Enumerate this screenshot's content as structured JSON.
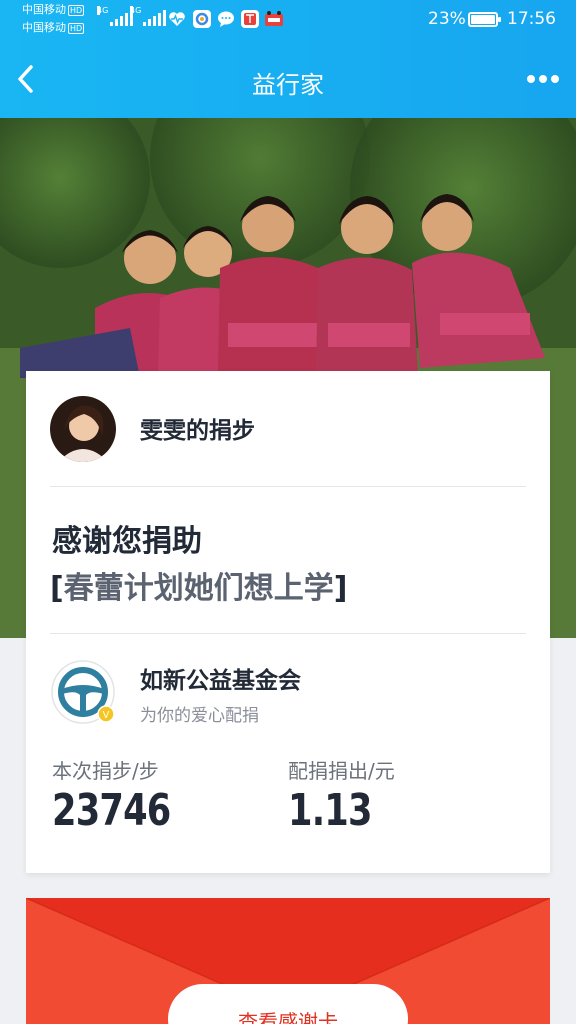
{
  "status_bar": {
    "carrier_1": "中国移动",
    "carrier_2": "中国移动",
    "hd_badge": "HD",
    "network": "4G",
    "battery": "23%",
    "time": "17:56"
  },
  "nav": {
    "title": "益行家",
    "back_icon": "chevron-left-icon",
    "more_icon": "more-dots-icon"
  },
  "donor": {
    "name": "雯雯的捐步"
  },
  "thanks": {
    "headline": "感谢您捐助",
    "project_name": "春蕾计划她们想上学",
    "bracket_open": "[",
    "bracket_close": "]"
  },
  "organization": {
    "name": "如新公益基金会",
    "subtitle": "为你的爱心配捐",
    "verified_badge": "V"
  },
  "stats": {
    "steps_label": "本次捐步/步",
    "steps_value": "23746",
    "amount_label": "配捐捐出/元",
    "amount_value": "1.13"
  },
  "envelope": {
    "button_label": "查看感谢卡"
  },
  "colors": {
    "brand_blue": "#19b6f3",
    "text_dark": "#222a38",
    "envelope_red": "#e8321f"
  }
}
